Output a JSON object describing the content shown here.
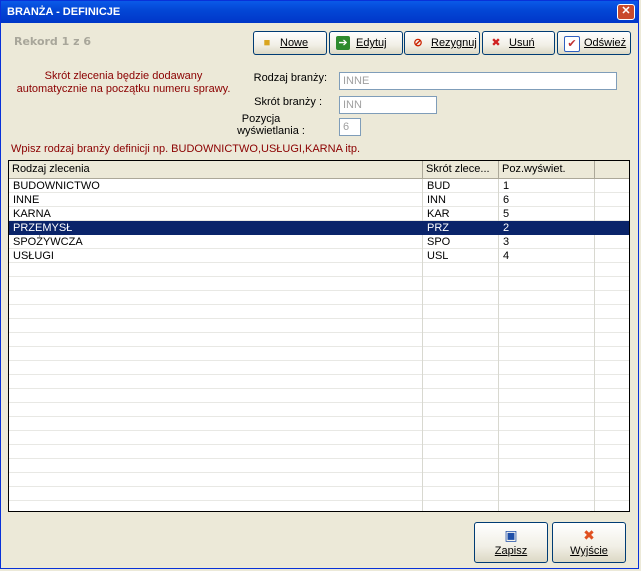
{
  "window": {
    "title": "BRANŻA - DEFINICJE",
    "close_label": "✕"
  },
  "record_label": "Rekord 1 z 6",
  "toolbar": [
    {
      "label": "Nowe",
      "icon": "folder-open-icon",
      "glyph": "📂",
      "color": "#d9a520"
    },
    {
      "label": "Edytuj",
      "icon": "arrow-right-icon",
      "glyph": "➔",
      "color": "#2e8b2e"
    },
    {
      "label": "Rezygnuj",
      "icon": "cancel-icon",
      "glyph": "⊘",
      "color": "#cc2200"
    },
    {
      "label": "Usuń",
      "icon": "delete-x-icon",
      "glyph": "✖",
      "color": "#d02020"
    },
    {
      "label": "Odśwież",
      "icon": "refresh-check-icon",
      "glyph": "✔",
      "color": "#3060c0"
    }
  ],
  "hint_text": "Skrót zlecenia będzie dodawany automatycznie na początku numeru sprawy.",
  "form": {
    "rodzaj_label": "Rodzaj branży:",
    "rodzaj_value": "INNE",
    "skrot_label": "Skrót branży :",
    "skrot_value": "INN",
    "pozycja_label_1": "Pozycja",
    "pozycja_label_2": "wyświetlania :",
    "pozycja_value": "6"
  },
  "instruction": "Wpisz rodzaj branży definicji np. BUDOWNICTWO,USŁUGI,KARNA itp.",
  "grid": {
    "columns": [
      "Rodzaj zlecenia",
      "Skrót zlece...",
      "Poz.wyświet."
    ],
    "rows": [
      [
        "BUDOWNICTWO",
        "BUD",
        "1"
      ],
      [
        "INNE",
        "INN",
        "6"
      ],
      [
        "KARNA",
        "KAR",
        "5"
      ],
      [
        "PRZEMYSŁ",
        "PRZ",
        "2"
      ],
      [
        "SPOŻYWCZA",
        "SPO",
        "3"
      ],
      [
        "USŁUGI",
        "USL",
        "4"
      ]
    ],
    "selected_row": 3
  },
  "buttons": {
    "zapisz": {
      "label": "Zapisz",
      "icon": "floppy-disk-icon",
      "glyph": "💾",
      "color": "#1f4fa8"
    },
    "wyjscie": {
      "label": "Wyjście",
      "icon": "exit-x-icon",
      "glyph": "✖",
      "color": "#e05020"
    }
  }
}
